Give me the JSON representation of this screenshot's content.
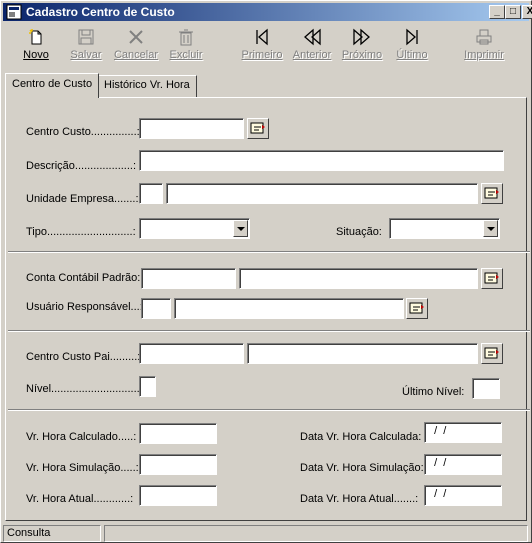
{
  "window": {
    "title": "Cadastro Centro de Custo",
    "controls": {
      "minimize": "_",
      "maximize": "□",
      "close": "X"
    }
  },
  "toolbar": {
    "items": [
      {
        "id": "novo",
        "label": "Novo",
        "icon": "new-document-icon",
        "enabled": true
      },
      {
        "id": "salvar",
        "label": "Salvar",
        "icon": "floppy-disk-icon",
        "enabled": false
      },
      {
        "id": "cancelar",
        "label": "Cancelar",
        "icon": "cancel-x-icon",
        "enabled": false
      },
      {
        "id": "excluir",
        "label": "Excluir",
        "icon": "trash-icon",
        "enabled": false
      },
      {
        "id": "primeiro",
        "label": "Primeiro",
        "icon": "first-record-icon",
        "enabled": false
      },
      {
        "id": "anterior",
        "label": "Anterior",
        "icon": "previous-record-icon",
        "enabled": false
      },
      {
        "id": "proximo",
        "label": "Próximo",
        "icon": "next-record-icon",
        "enabled": false
      },
      {
        "id": "ultimo",
        "label": "Último",
        "icon": "last-record-icon",
        "enabled": false
      },
      {
        "id": "imprimir",
        "label": "Imprimir",
        "icon": "printer-icon",
        "enabled": false
      }
    ]
  },
  "tabs": [
    {
      "label": "Centro de Custo",
      "active": true
    },
    {
      "label": "Histórico Vr. Hora",
      "active": false
    }
  ],
  "form": {
    "centro_custo": {
      "label": "Centro Custo...............:",
      "value": ""
    },
    "descricao": {
      "label": "Descrição...................:",
      "value": ""
    },
    "unidade_empresa": {
      "label": "Unidade Empresa.......:",
      "code": "",
      "name": ""
    },
    "tipo": {
      "label": "Tipo............................:",
      "value": ""
    },
    "situacao": {
      "label": "Situação:",
      "value": ""
    },
    "conta_contabil": {
      "label": "Conta Contábil Padrão:",
      "code": "",
      "name": ""
    },
    "usuario_responsavel": {
      "label": "Usuário Responsável...:",
      "code": "",
      "name": ""
    },
    "centro_custo_pai": {
      "label": "Centro Custo Pai.........:",
      "code": "",
      "name": ""
    },
    "nivel": {
      "label": "Nível...............................:",
      "value": ""
    },
    "ultimo_nivel": {
      "label": "Último Nível:",
      "value": ""
    },
    "vr_hora_calculado": {
      "label": "Vr. Hora Calculado.....:",
      "value": ""
    },
    "vr_hora_simulacao": {
      "label": "Vr. Hora Simulação.....:",
      "value": ""
    },
    "vr_hora_atual": {
      "label": "Vr. Hora Atual............:",
      "value": ""
    },
    "data_vr_hora_calculada": {
      "label": "Data Vr. Hora Calculada:",
      "value": "  /  /"
    },
    "data_vr_hora_simulacao": {
      "label": "Data Vr. Hora Simulação:",
      "value": "  /  /"
    },
    "data_vr_hora_atual": {
      "label": "Data Vr. Hora Atual.......:",
      "value": "  /  /"
    }
  },
  "status": {
    "mode": "Consulta",
    "message": ""
  },
  "colors": {
    "title_start": "#0a246a",
    "title_end": "#a6caf0",
    "face": "#d4d0c8",
    "disabled_text": "#808080"
  }
}
